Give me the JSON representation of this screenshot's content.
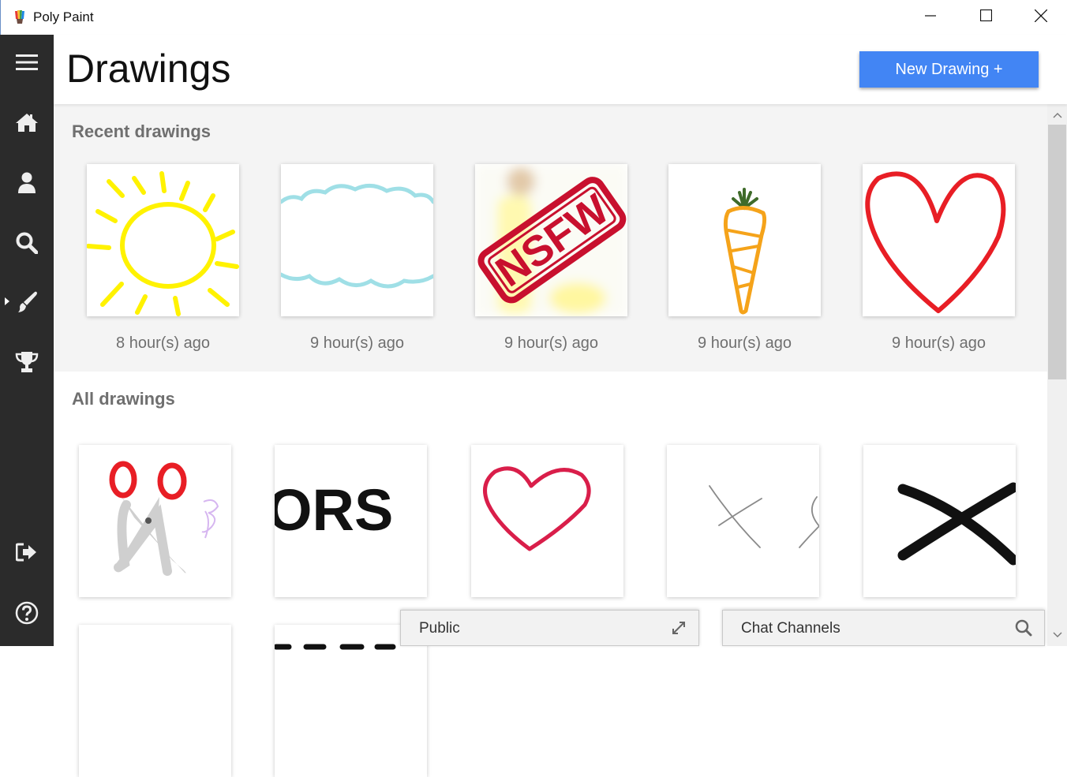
{
  "window": {
    "title": "Poly Paint",
    "controls": [
      "minimize-icon",
      "maximize-icon",
      "close-icon"
    ]
  },
  "sidebar": {
    "items": [
      {
        "icon": "menu-icon"
      },
      {
        "icon": "home-icon"
      },
      {
        "icon": "user-icon"
      },
      {
        "icon": "search-icon"
      },
      {
        "icon": "brush-icon",
        "active": true
      },
      {
        "icon": "trophy-icon"
      },
      {
        "icon": "logout-icon"
      },
      {
        "icon": "help-icon"
      }
    ]
  },
  "header": {
    "title": "Drawings",
    "new_button": "New Drawing +",
    "accent": "#4285f4"
  },
  "recent": {
    "title": "Recent drawings",
    "items": [
      {
        "drawing": "sun",
        "time": "8 hour(s) ago"
      },
      {
        "drawing": "cloud",
        "time": "9 hour(s) ago"
      },
      {
        "drawing": "nsfw-blurred",
        "stamp": "NSFW",
        "time": "9 hour(s) ago"
      },
      {
        "drawing": "carrot",
        "time": "9 hour(s) ago"
      },
      {
        "drawing": "heart",
        "time": "9 hour(s) ago"
      }
    ]
  },
  "all": {
    "title": "All drawings",
    "items": [
      {
        "drawing": "scissors"
      },
      {
        "drawing": "handwriting",
        "text": "ORS"
      },
      {
        "drawing": "heart"
      },
      {
        "drawing": "pencil-marks"
      },
      {
        "drawing": "black-x"
      }
    ]
  },
  "chat": {
    "public_label": "Public",
    "channels_label": "Chat Channels"
  }
}
